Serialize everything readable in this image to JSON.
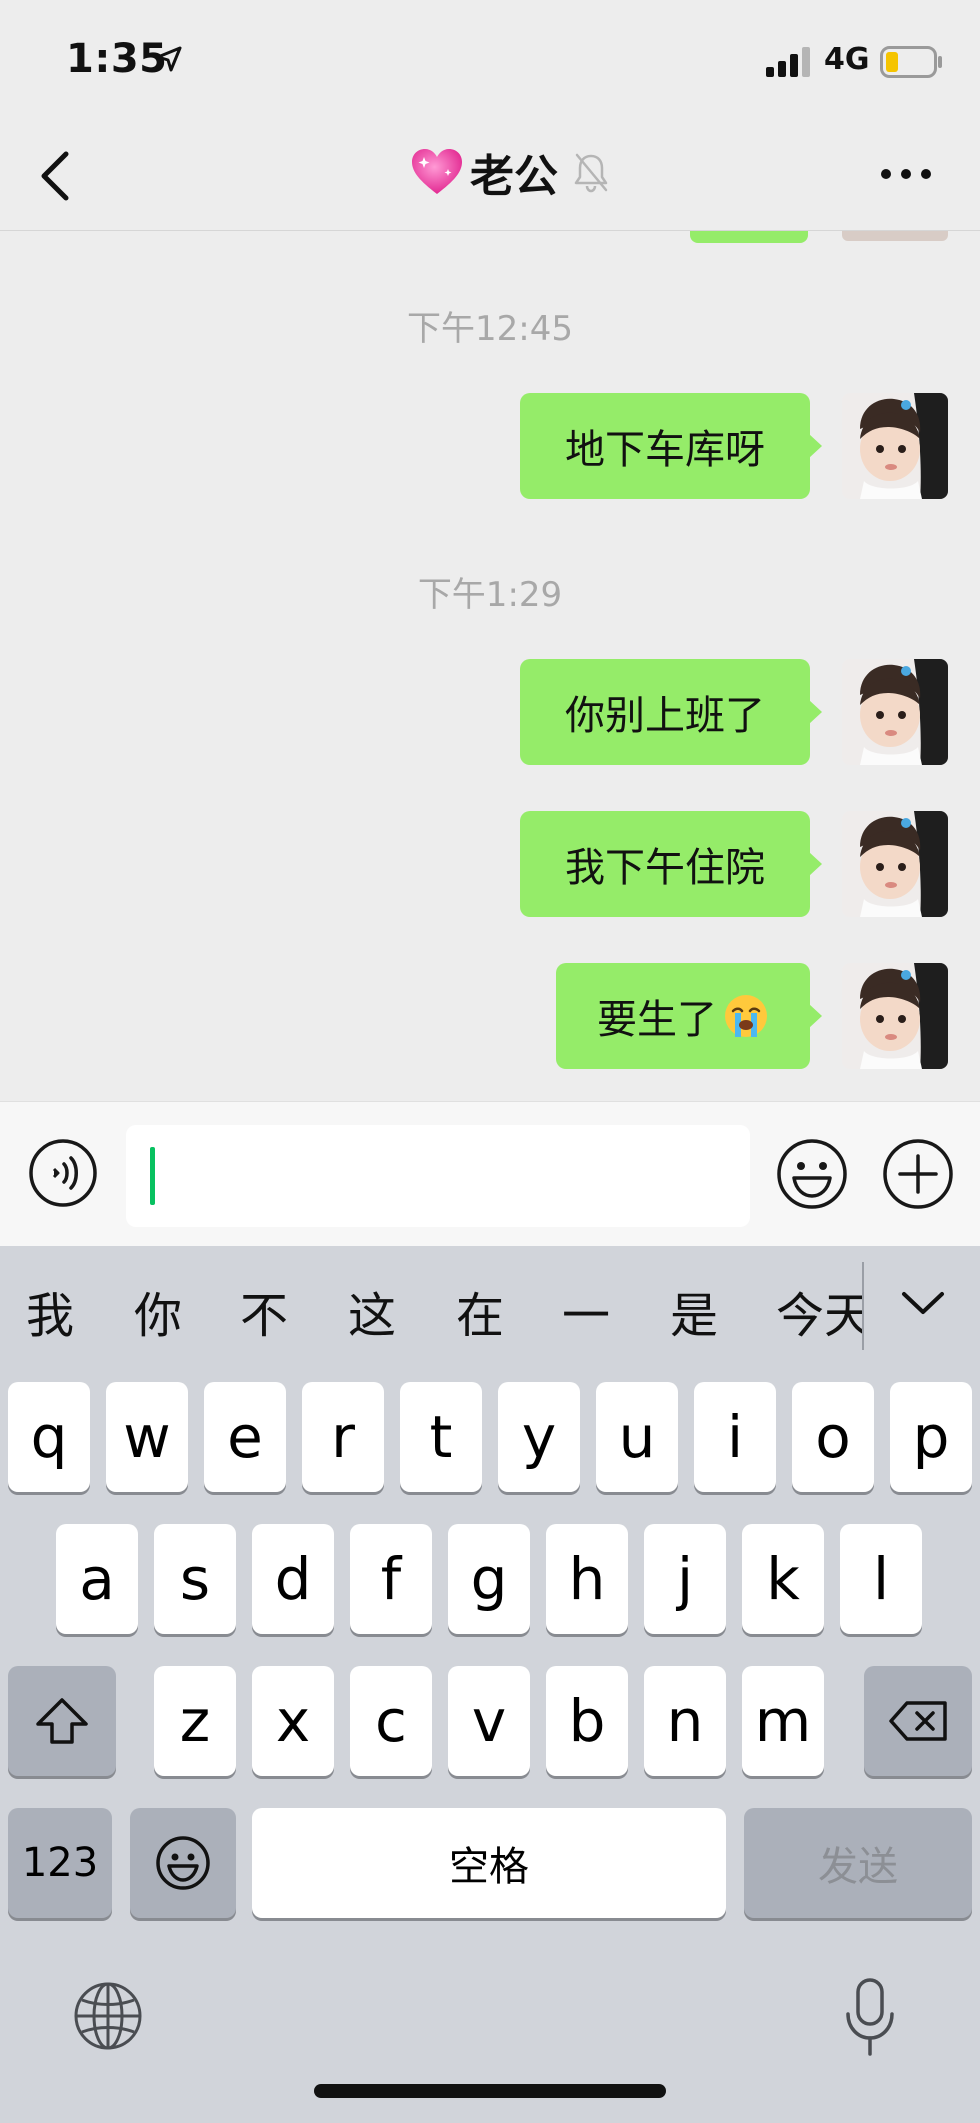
{
  "status_bar": {
    "time": "1:35",
    "network": "4G",
    "signal_icon": "signal-bars-icon",
    "location_icon": "location-arrow-icon",
    "battery_icon": "battery-low-icon",
    "battery_color": "#f5c400"
  },
  "nav": {
    "title": "老公",
    "back_icon": "chevron-left-icon",
    "heart_icon": "sparkling-heart-icon",
    "mute_icon": "bell-muted-icon",
    "more_icon": "more-dots-icon"
  },
  "chat": {
    "bubble_color": "#95ec69",
    "messages": [
      {
        "type": "time",
        "text": "下午12:45"
      },
      {
        "type": "sent",
        "text": "地下车库呀"
      },
      {
        "type": "time",
        "text": "下午1:29"
      },
      {
        "type": "sent",
        "text": "你别上班了"
      },
      {
        "type": "sent",
        "text": "我下午住院"
      },
      {
        "type": "sent",
        "text": "要生了",
        "emoji": "crying-face-icon"
      }
    ]
  },
  "input": {
    "value": "",
    "voice_icon": "voice-input-icon",
    "emoji_icon": "smiley-icon",
    "plus_icon": "plus-circle-icon",
    "caret_color": "#07c160"
  },
  "keyboard": {
    "candidates": [
      "我",
      "你",
      "不",
      "这",
      "在",
      "一",
      "是",
      "今天"
    ],
    "collapse_icon": "chevron-down-icon",
    "row1": [
      "q",
      "w",
      "e",
      "r",
      "t",
      "y",
      "u",
      "i",
      "o",
      "p"
    ],
    "row2": [
      "a",
      "s",
      "d",
      "f",
      "g",
      "h",
      "j",
      "k",
      "l"
    ],
    "row3": [
      "z",
      "x",
      "c",
      "v",
      "b",
      "n",
      "m"
    ],
    "shift_icon": "shift-arrow-icon",
    "delete_icon": "backspace-icon",
    "numbers_label": "123",
    "emoji_key_icon": "emoji-keyboard-icon",
    "space_label": "空格",
    "send_label": "发送",
    "globe_icon": "globe-icon",
    "mic_icon": "microphone-icon"
  }
}
